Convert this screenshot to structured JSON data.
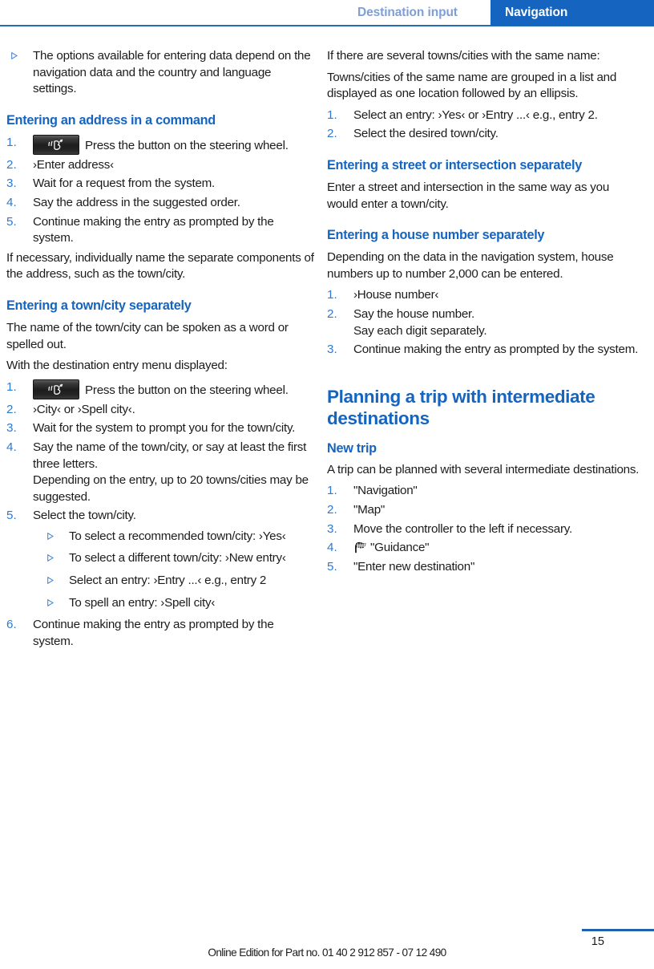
{
  "header": {
    "inactive_tab": "Destination input",
    "active_tab": "Navigation",
    "accent_color": "#1565c0",
    "inactive_color": "#7e9fd4"
  },
  "left_column": {
    "intro_bullet": "The options available for entering data depend on the navigation data and the country and language settings.",
    "section1": {
      "heading": "Entering an address in a command",
      "steps": [
        {
          "num": "1.",
          "text": "Press the button on the steering wheel.",
          "icon": "speech-button-icon"
        },
        {
          "num": "2.",
          "text": "›Enter address‹"
        },
        {
          "num": "3.",
          "text": "Wait for a request from the system."
        },
        {
          "num": "4.",
          "text": "Say the address in the suggested order."
        },
        {
          "num": "5.",
          "text": "Continue making the entry as prompted by the system."
        }
      ],
      "after_text": "If necessary, individually name the separate components of the address, such as the town/city."
    },
    "section2": {
      "heading": "Entering a town/city separately",
      "para1": "The name of the town/city can be spoken as a word or spelled out.",
      "para2": "With the destination entry menu displayed:",
      "steps": [
        {
          "num": "1.",
          "text": "Press the button on the steering wheel.",
          "icon": "speech-button-icon"
        },
        {
          "num": "2.",
          "text": "›City‹ or ›Spell city‹."
        },
        {
          "num": "3.",
          "text": "Wait for the system to prompt you for the town/city."
        },
        {
          "num": "4.",
          "text": "Say the name of the town/city, or say at least the first three letters.",
          "sub": "Depending on the entry, up to 20 towns/cities may be suggested."
        },
        {
          "num": "5.",
          "text": "Select the town/city.",
          "bullets": [
            "To select a recommended town/city: ›Yes‹",
            "To select a different town/city: ›New entry‹",
            "Select an entry: ›Entry ...‹ e.g., entry 2",
            "To spell an entry: ›Spell city‹"
          ]
        },
        {
          "num": "6.",
          "text": "Continue making the entry as prompted by the system."
        }
      ]
    }
  },
  "right_column": {
    "para1": "If there are several towns/cities with the same name:",
    "para2": "Towns/cities of the same name are grouped in a list and displayed as one location followed by an ellipsis.",
    "steps1": [
      {
        "num": "1.",
        "text": "Select an entry: ›Yes‹ or ›Entry ...‹ e.g., entry 2."
      },
      {
        "num": "2.",
        "text": "Select the desired town/city."
      }
    ],
    "section3": {
      "heading": "Entering a street or intersection separately",
      "para": "Enter a street and intersection in the same way as you would enter a town/city."
    },
    "section4": {
      "heading": "Entering a house number separately",
      "para": "Depending on the data in the navigation system, house numbers up to number 2,000 can be entered.",
      "steps": [
        {
          "num": "1.",
          "text": "›House number‹"
        },
        {
          "num": "2.",
          "text": "Say the house number.",
          "sub": "Say each digit separately."
        },
        {
          "num": "3.",
          "text": "Continue making the entry as prompted by the system."
        }
      ]
    },
    "chapter": {
      "title": "Planning a trip with intermediate destinations",
      "subheading": "New trip",
      "para": "A trip can be planned with several intermediate destinations.",
      "steps": [
        {
          "num": "1.",
          "text": "\"Navigation\""
        },
        {
          "num": "2.",
          "text": "\"Map\""
        },
        {
          "num": "3.",
          "text": "Move the controller to the left if necessary."
        },
        {
          "num": "4.",
          "text": "\"Guidance\"",
          "icon": "checkered-flag-icon"
        },
        {
          "num": "5.",
          "text": "\"Enter new destination\""
        }
      ]
    }
  },
  "footer": {
    "note": "Online Edition for Part no. 01 40 2 912 857 - 07 12 490",
    "page": "15"
  }
}
